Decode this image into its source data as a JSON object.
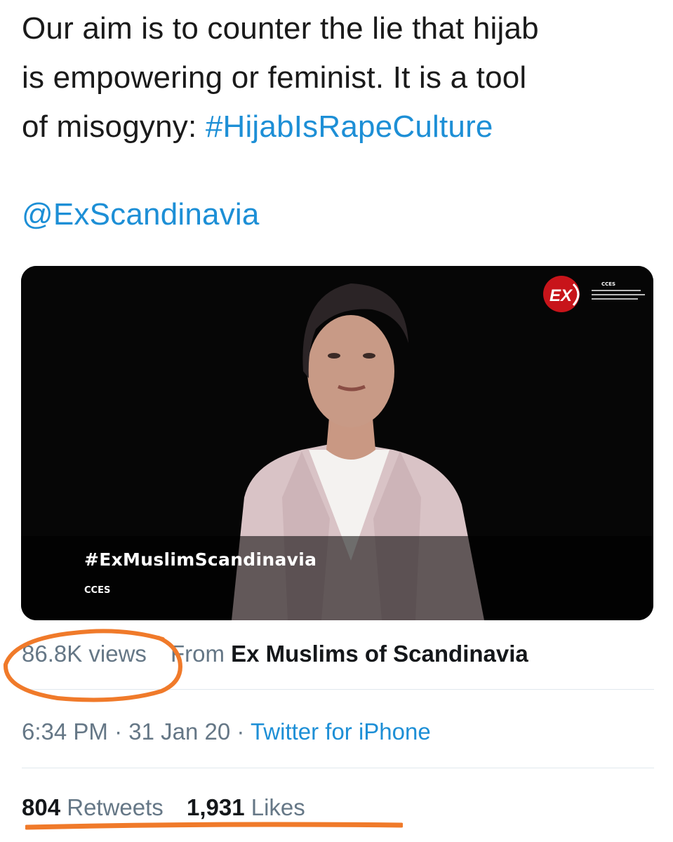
{
  "tweet": {
    "text_line_1": "Our aim is to counter the lie that hijab",
    "text_line_2": "is empowering or feminist. It is a tool",
    "text_line_3_prefix": "of misogyny: ",
    "hashtag": "#HijabIsRapeCulture",
    "mention": "@ExScandinavia"
  },
  "media": {
    "type": "video",
    "lower_third_title": "#ExMuslimScandinavia",
    "lower_third_subtitle": "CCES",
    "logo_mark": "EX",
    "logo_text": "CCES"
  },
  "meta": {
    "views": "86.8K views",
    "from_label": "From",
    "from_account": "Ex Muslims of Scandinavia"
  },
  "timestamp": {
    "time": "6:34 PM",
    "separator": " · ",
    "date": "31 Jan 20",
    "client": "Twitter for iPhone"
  },
  "stats": {
    "retweets_count": "804",
    "retweets_label": "Retweets",
    "likes_count": "1,931",
    "likes_label": "Likes"
  },
  "colors": {
    "link": "#1d8fd6",
    "secondary_text": "#657786",
    "annotation": "#f07a2a"
  }
}
